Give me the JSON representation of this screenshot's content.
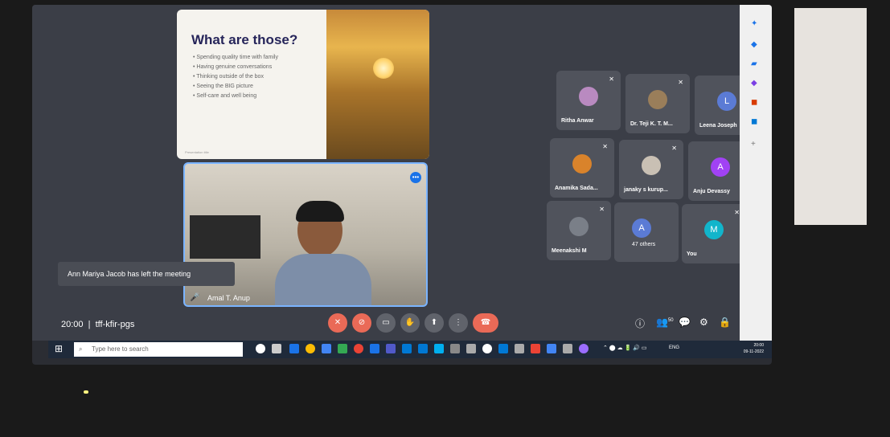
{
  "slide": {
    "title": "What are those?",
    "bullets": [
      "Spending quality time with family",
      "Having genuine conversations",
      "Thinking outside of the box",
      "Seeing the BIG picture",
      "Self-care and well being"
    ],
    "footer": "Presentation title"
  },
  "speaker": {
    "name": "Amal T. Anup"
  },
  "toast": "Ann Mariya Jacob has left the meeting",
  "participants": [
    {
      "name": "Ritha Anwar"
    },
    {
      "name": "Dr. Teji K. T. M..."
    },
    {
      "name": "Leena Joseph",
      "initial": "L"
    },
    {
      "name": "Anamika Sada..."
    },
    {
      "name": "janaky s kurup..."
    },
    {
      "name": "Anju Devassy",
      "initial": "A"
    },
    {
      "name": "Meenakshi M"
    },
    {
      "name": "47 others",
      "initial": "A"
    },
    {
      "name": "You",
      "initial": "M"
    }
  ],
  "meeting": {
    "time": "20:00",
    "code": "tff-kfir-pgs",
    "people_count": "50"
  },
  "taskbar": {
    "search_placeholder": "Type here to search",
    "language": "ENG",
    "time": "20:00",
    "date": "09-11-2022"
  },
  "colors": {
    "end_call": "#ea6a57",
    "accent": "#1a73e8",
    "avatar_L": "#5b7bd5",
    "avatar_A": "#a142f4",
    "avatar_M": "#12b5cb"
  }
}
